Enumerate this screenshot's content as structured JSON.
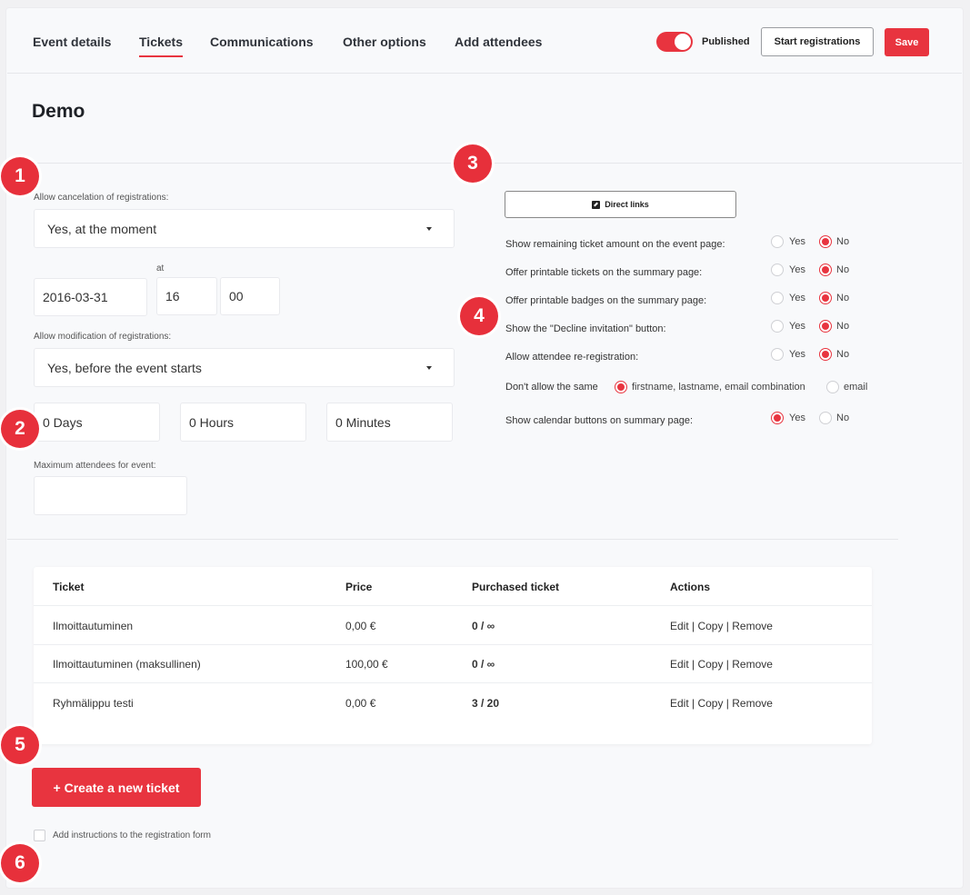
{
  "nav": {
    "tabs": [
      "Event details",
      "Tickets",
      "Communications",
      "Other options",
      "Add attendees"
    ],
    "active_tab": "Tickets",
    "published_label": "Published",
    "published": true,
    "start_registrations": "Start registrations",
    "save": "Save"
  },
  "page_title": "Demo",
  "markers": [
    "1",
    "2",
    "3",
    "4",
    "5",
    "6"
  ],
  "cancellation": {
    "label": "Allow cancelation of registrations:",
    "value": "Yes, at the moment",
    "at_label": "at",
    "date": "2016-03-31",
    "hour": "16",
    "minute": "00"
  },
  "modification": {
    "label": "Allow modification of registrations:",
    "value": "Yes, before the event starts",
    "days": "0 Days",
    "hours": "0 Hours",
    "minutes": "0 Minutes"
  },
  "max_attendees": {
    "label": "Maximum attendees for event:",
    "value": ""
  },
  "direct_links": "Direct links",
  "options": [
    {
      "label": "Show remaining ticket amount on the event page:",
      "yes": "Yes",
      "no": "No",
      "selected": "No"
    },
    {
      "label": "Offer printable tickets on the summary page:",
      "yes": "Yes",
      "no": "No",
      "selected": "No"
    },
    {
      "label": "Offer printable badges on the summary page:",
      "yes": "Yes",
      "no": "No",
      "selected": "No"
    },
    {
      "label": "Show the \"Decline invitation\" button:",
      "yes": "Yes",
      "no": "No",
      "selected": "No"
    },
    {
      "label": "Allow attendee re-registration:",
      "yes": "Yes",
      "no": "No",
      "selected": "No"
    }
  ],
  "duplicate": {
    "label": "Don't allow the same",
    "opt1": "firstname, lastname, email combination",
    "opt2": "email",
    "selected": "opt1"
  },
  "calendar": {
    "label": "Show calendar buttons on summary page:",
    "yes": "Yes",
    "no": "No",
    "selected": "Yes"
  },
  "table": {
    "headers": [
      "Ticket",
      "Price",
      "Purchased ticket",
      "Actions"
    ],
    "rows": [
      {
        "ticket": "Ilmoittautuminen",
        "price": "0,00 €",
        "purchased": "0 / ∞",
        "actions": "Edit | Copy | Remove"
      },
      {
        "ticket": "Ilmoittautuminen (maksullinen)",
        "price": "100,00 €",
        "purchased": "0 / ∞",
        "actions": "Edit | Copy | Remove"
      },
      {
        "ticket": "Ryhmälippu testi",
        "price": "0,00 €",
        "purchased": "3 / 20",
        "actions": "Edit | Copy | Remove"
      }
    ]
  },
  "create_ticket": "+ Create a new ticket",
  "instructions_label": "Add instructions to the registration form",
  "colors": {
    "accent": "#e8343f"
  }
}
